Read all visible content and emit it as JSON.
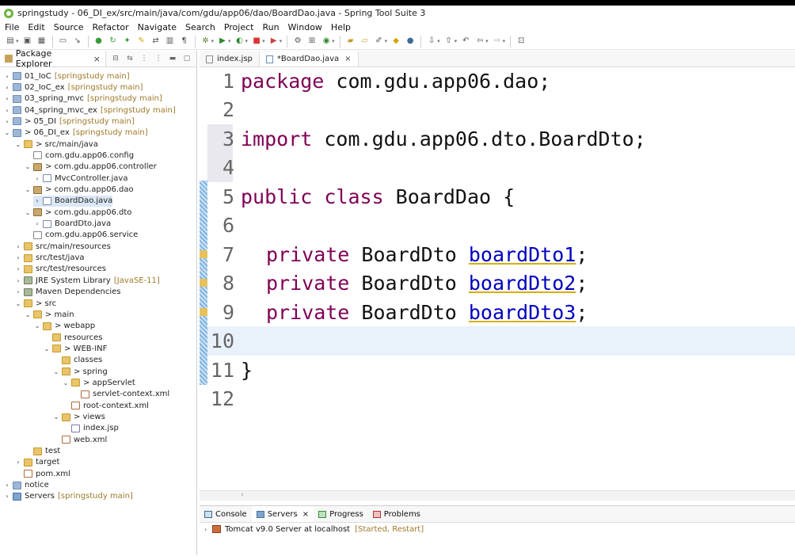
{
  "window": {
    "title": "springstudy - 06_DI_ex/src/main/java/com/gdu/app06/dao/BoardDao.java - Spring Tool Suite 3"
  },
  "menu": [
    "File",
    "Edit",
    "Source",
    "Refactor",
    "Navigate",
    "Search",
    "Project",
    "Run",
    "Window",
    "Help"
  ],
  "package_explorer": {
    "tab_label": "Package Explorer",
    "rows": [
      {
        "arrow": "›",
        "icon": "proj",
        "label": "01_IoC",
        "deco": "[springstudy main]"
      },
      {
        "arrow": "›",
        "icon": "proj",
        "label": "02_IoC_ex",
        "deco": "[springstudy main]"
      },
      {
        "arrow": "›",
        "icon": "proj",
        "label": "03_spring_mvc",
        "deco": "[springstudy main]"
      },
      {
        "arrow": "›",
        "icon": "proj",
        "label": "04_spring_mvc_ex",
        "deco": "[springstudy main]"
      },
      {
        "arrow": "›",
        "icon": "proj",
        "label": "> 05_DI",
        "deco": "[springstudy main]"
      },
      {
        "arrow": "⌄",
        "icon": "proj",
        "label": "> 06_DI_ex",
        "deco": "[springstudy main]"
      },
      {
        "arrow": "⌄",
        "icon": "folder",
        "label": "> src/main/java",
        "deco": ""
      },
      {
        "arrow": "",
        "icon": "pkgempty",
        "label": "com.gdu.app06.config",
        "deco": ""
      },
      {
        "arrow": "⌄",
        "icon": "pkg",
        "label": "> com.gdu.app06.controller",
        "deco": ""
      },
      {
        "arrow": "›",
        "icon": "java",
        "label": "MvcController.java",
        "deco": ""
      },
      {
        "arrow": "⌄",
        "icon": "pkg",
        "label": "> com.gdu.app06.dao",
        "deco": ""
      },
      {
        "arrow": "›",
        "icon": "java",
        "label": "BoardDao.java",
        "deco": ""
      },
      {
        "arrow": "⌄",
        "icon": "pkg",
        "label": "> com.gdu.app06.dto",
        "deco": ""
      },
      {
        "arrow": "›",
        "icon": "java",
        "label": "BoardDto.java",
        "deco": ""
      },
      {
        "arrow": "",
        "icon": "pkgempty",
        "label": "com.gdu.app06.service",
        "deco": ""
      },
      {
        "arrow": "›",
        "icon": "folder",
        "label": "src/main/resources",
        "deco": ""
      },
      {
        "arrow": "›",
        "icon": "folder",
        "label": "src/test/java",
        "deco": ""
      },
      {
        "arrow": "›",
        "icon": "folder",
        "label": "src/test/resources",
        "deco": ""
      },
      {
        "arrow": "›",
        "icon": "lib",
        "label": "JRE System Library",
        "deco": "[JavaSE-11]"
      },
      {
        "arrow": "›",
        "icon": "lib",
        "label": "Maven Dependencies",
        "deco": ""
      },
      {
        "arrow": "⌄",
        "icon": "folder",
        "label": "> src",
        "deco": ""
      },
      {
        "arrow": "⌄",
        "icon": "folder",
        "label": "> main",
        "deco": ""
      },
      {
        "arrow": "⌄",
        "icon": "folder",
        "label": "> webapp",
        "deco": ""
      },
      {
        "arrow": "",
        "icon": "folder",
        "label": "resources",
        "deco": ""
      },
      {
        "arrow": "⌄",
        "icon": "folder",
        "label": "> WEB-INF",
        "deco": ""
      },
      {
        "arrow": "",
        "icon": "folder",
        "label": "classes",
        "deco": ""
      },
      {
        "arrow": "⌄",
        "icon": "folder",
        "label": "> spring",
        "deco": ""
      },
      {
        "arrow": "⌄",
        "icon": "folder",
        "label": "> appServlet",
        "deco": ""
      },
      {
        "arrow": "",
        "icon": "xml",
        "label": "servlet-context.xml",
        "deco": ""
      },
      {
        "arrow": "",
        "icon": "xml",
        "label": "root-context.xml",
        "deco": ""
      },
      {
        "arrow": "⌄",
        "icon": "folder",
        "label": "> views",
        "deco": ""
      },
      {
        "arrow": "",
        "icon": "jsp",
        "label": "index.jsp",
        "deco": ""
      },
      {
        "arrow": "",
        "icon": "xml",
        "label": "web.xml",
        "deco": ""
      },
      {
        "arrow": "",
        "icon": "folder",
        "label": "test",
        "deco": ""
      },
      {
        "arrow": "›",
        "icon": "folder",
        "label": "target",
        "deco": ""
      },
      {
        "arrow": "",
        "icon": "xml",
        "label": "pom.xml",
        "deco": ""
      },
      {
        "arrow": "›",
        "icon": "proj",
        "label": "notice",
        "deco": ""
      },
      {
        "arrow": "›",
        "icon": "srv",
        "label": "Servers",
        "deco": "[springstudy main]"
      }
    ]
  },
  "editor": {
    "tabs": [
      {
        "label": "index.jsp"
      },
      {
        "label": "*BoardDao.java"
      }
    ],
    "lines": [
      {
        "n": "1"
      },
      {
        "n": "2"
      },
      {
        "n": "3"
      },
      {
        "n": "4"
      },
      {
        "n": "5"
      },
      {
        "n": "6"
      },
      {
        "n": "7"
      },
      {
        "n": "8"
      },
      {
        "n": "9"
      },
      {
        "n": "10"
      },
      {
        "n": "11"
      },
      {
        "n": "12"
      }
    ],
    "code": {
      "l1_kw": "package",
      "l1_rest": " com.gdu.app06.dao;",
      "l3_kw": "import",
      "l3_rest": " com.gdu.app06.dto.BoardDto;",
      "l5_kw": "public class",
      "l5_rest": " BoardDao {",
      "l7_kw": "private",
      "l7_type": " BoardDto ",
      "l7_field": "boardDto1",
      "l7_end": ";",
      "l8_kw": "private",
      "l8_type": " BoardDto ",
      "l8_field": "boardDto2",
      "l8_end": ";",
      "l9_kw": "private",
      "l9_type": " BoardDto ",
      "l9_field": "boardDto3",
      "l9_end": ";",
      "l11": "}"
    }
  },
  "bottom_panel": {
    "tabs": [
      {
        "label": "Console"
      },
      {
        "label": "Servers"
      },
      {
        "label": "Progress"
      },
      {
        "label": "Problems"
      }
    ],
    "server_row": {
      "label": "Tomcat v9.0 Server at localhost",
      "status": "[Started, Restart]"
    }
  },
  "colors": {
    "keyword": "#7f0055",
    "field": "#0000c0",
    "selection": "#dbe7f6",
    "current_line": "#e9f1fb"
  }
}
